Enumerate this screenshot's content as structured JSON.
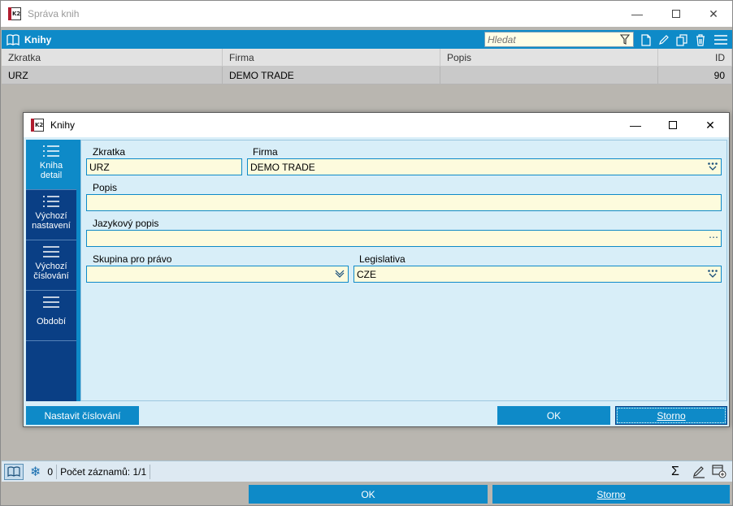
{
  "window": {
    "title": "Správa knih"
  },
  "toolbar": {
    "title": "Knihy",
    "search_placeholder": "Hledat"
  },
  "grid": {
    "columns": [
      "Zkratka",
      "Firma",
      "Popis",
      "ID"
    ],
    "rows": [
      {
        "zkratka": "URZ",
        "firma": "DEMO TRADE",
        "popis": "",
        "id": "90"
      }
    ]
  },
  "statusbar": {
    "count": "0",
    "records": "Počet záznamů: 1/1"
  },
  "footer": {
    "ok": "OK",
    "storno": "Storno"
  },
  "dialog": {
    "title": "Knihy",
    "tabs": [
      {
        "line1": "Kniha",
        "line2": "detail"
      },
      {
        "line1": "Výchozí",
        "line2": "nastavení"
      },
      {
        "line1": "Výchozí",
        "line2": "číslování"
      },
      {
        "line1": "Období",
        "line2": ""
      }
    ],
    "fields": {
      "zkratka_label": "Zkratka",
      "zkratka_value": "URZ",
      "firma_label": "Firma",
      "firma_value": "DEMO TRADE",
      "popis_label": "Popis",
      "popis_value": "",
      "jazykovy_label": "Jazykový popis",
      "jazykovy_value": "",
      "skupina_label": "Skupina pro právo",
      "skupina_value": "",
      "legislativa_label": "Legislativa",
      "legislativa_value": "CZE"
    },
    "buttons": {
      "numbering": "Nastavit číslování",
      "ok": "OK",
      "storno": "Storno"
    }
  },
  "colors": {
    "accent": "#0e8ac8",
    "sidebar": "#0a3f85",
    "field_bg": "#fdfbdd",
    "dialog_bg": "#d8eef8"
  }
}
